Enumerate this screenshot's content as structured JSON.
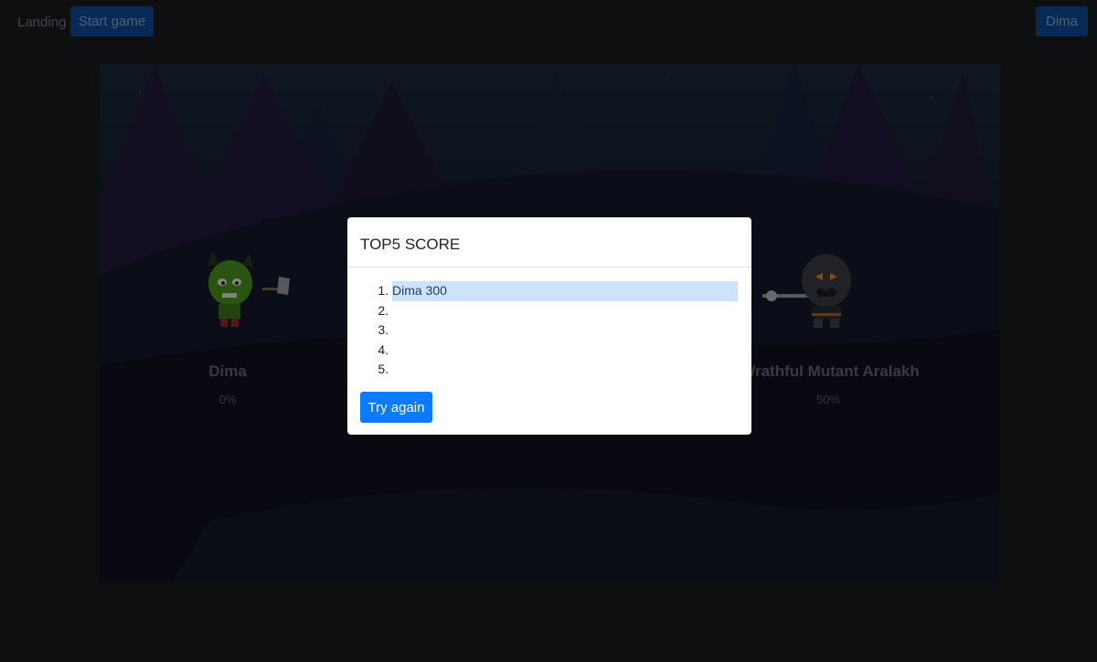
{
  "nav": {
    "landing_label": "Landing",
    "start_game_label": "Start game",
    "user_label": "Dima"
  },
  "arena": {
    "player": {
      "name": "Dima",
      "health": "0%"
    },
    "enemy": {
      "name": "Wrathful Mutant Aralakh",
      "health": "50%"
    }
  },
  "modal": {
    "title": "TOP5 SCORE",
    "scores": [
      {
        "rank": "1.",
        "text": "Dima 300"
      },
      {
        "rank": "2.",
        "text": ""
      },
      {
        "rank": "3.",
        "text": ""
      },
      {
        "rank": "4.",
        "text": ""
      },
      {
        "rank": "5.",
        "text": ""
      }
    ],
    "try_again_label": "Try again"
  },
  "colors": {
    "page_bg": "#191c1f",
    "primary": "#0c7bff",
    "highlight": "#cfe2fc"
  }
}
